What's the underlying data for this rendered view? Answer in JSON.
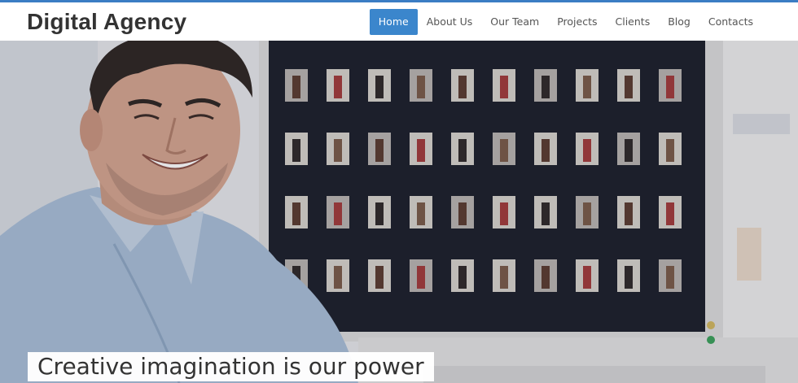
{
  "site": {
    "logo": "Digital Agency"
  },
  "nav": {
    "items": [
      {
        "label": "Home",
        "active": true
      },
      {
        "label": "About Us"
      },
      {
        "label": "Our Team"
      },
      {
        "label": "Projects"
      },
      {
        "label": "Clients"
      },
      {
        "label": "Blog"
      },
      {
        "label": "Contacts"
      }
    ]
  },
  "hero": {
    "tagline": "Creative imagination is our power",
    "image": "smiling-man-at-computer-monitor"
  },
  "colors": {
    "accent": "#3b86cc",
    "top_bar": "#3b7dc4",
    "text": "#333333"
  }
}
